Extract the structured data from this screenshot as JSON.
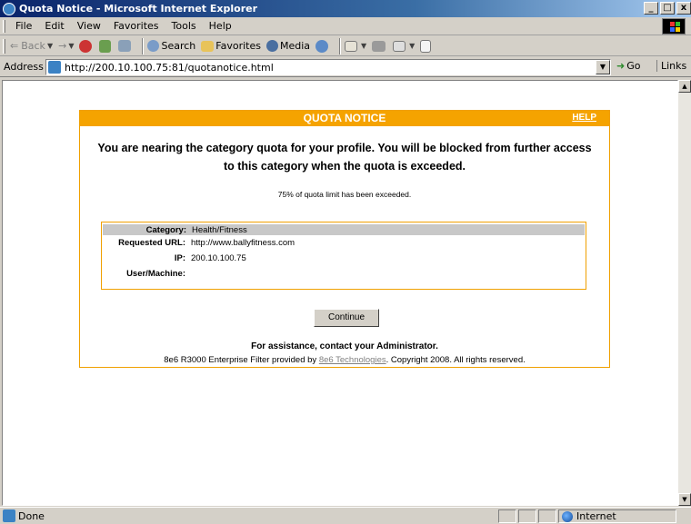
{
  "window": {
    "title": "Quota Notice - Microsoft Internet Explorer",
    "btn_min": "_",
    "btn_max": "□",
    "btn_close": "x"
  },
  "menu": [
    "File",
    "Edit",
    "View",
    "Favorites",
    "Tools",
    "Help"
  ],
  "toolbar": {
    "back": "Back",
    "forward": "→",
    "search": "Search",
    "favorites": "Favorites",
    "media": "Media"
  },
  "address": {
    "label": "Address",
    "url": "http://200.10.100.75:81/quotanotice.html",
    "go": "Go",
    "links": "Links"
  },
  "notice": {
    "heading": "QUOTA NOTICE",
    "help": "HELP",
    "warning_line1": "You are nearing the category quota for your profile. You will be blocked from further access",
    "warning_line2": "to this category when the quota is exceeded.",
    "percent_text": "75% of quota limit has been exceeded.",
    "quota_percent": 75,
    "rows": [
      {
        "key": "Category:",
        "value": "Health/Fitness"
      },
      {
        "key": "Requested URL:",
        "value": "http://www.ballyfitness.com"
      },
      {
        "key": "IP:",
        "value": "200.10.100.75"
      },
      {
        "key": "User/Machine:",
        "value": ""
      }
    ],
    "continue": "Continue",
    "assistance": "For assistance, contact your Administrator.",
    "footer_pre": "8e6 R3000 Enterprise Filter provided by ",
    "footer_link": "8e6 Technologies",
    "footer_post": ". Copyright 2008. All rights reserved."
  },
  "status": {
    "text": "Done",
    "zone": "Internet"
  },
  "colors": {
    "accent": "#f5a300",
    "titlebar": "#0a246a"
  }
}
